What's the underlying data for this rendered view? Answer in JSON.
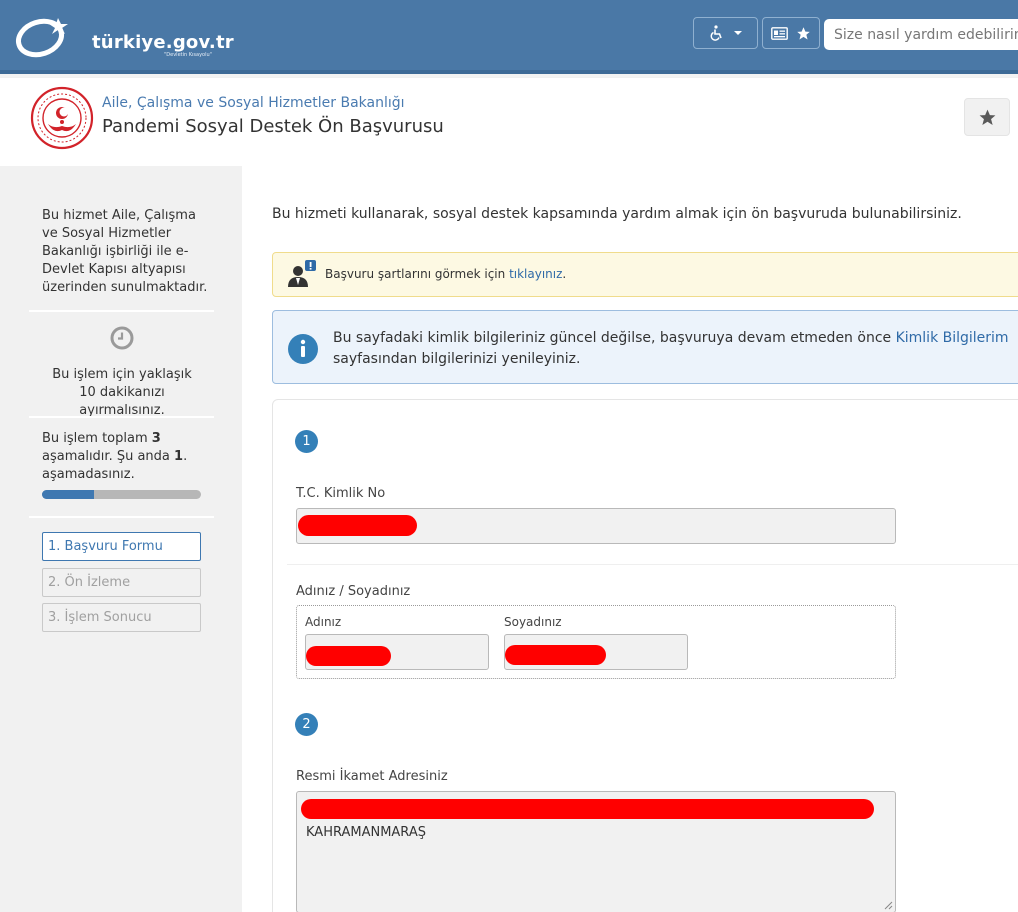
{
  "brand": {
    "name": "türkiye.gov.tr",
    "tagline": "\"Devletin Kısayolu\""
  },
  "topbar": {
    "accessibility_icon": "wheelchair-icon",
    "chevron_icon": "chevron-down-icon",
    "id_card_icon": "id-card-icon",
    "star_icon": "star-icon",
    "search_placeholder": "Size nasıl yardım edebilirim?"
  },
  "agency": {
    "ministry": "Aile, Çalışma ve Sosyal Hizmetler Bakanlığı",
    "service": "Pandemi Sosyal Destek Ön Başvurusu",
    "favorite_icon": "star-icon"
  },
  "sidebar": {
    "about": "Bu hizmet Aile, Çalışma ve Sosyal Hizmetler Bakanlığı işbirliği ile e-Devlet Kapısı altyapısı üzerinden sunulmaktadır.",
    "time_note": "Bu işlem için yaklaşık 10 dakikanızı ayırmalısınız.",
    "stage_text_a": "Bu işlem toplam ",
    "stage_total": "3",
    "stage_text_b": " aşamalıdır. Şu anda ",
    "stage_current": "1",
    "stage_text_c": ". aşamadasınız.",
    "progress_fraction": 0.33,
    "steps": [
      {
        "label": "1. Başvuru Formu",
        "active": true
      },
      {
        "label": "2. Ön İzleme",
        "active": false
      },
      {
        "label": "3. İşlem Sonucu",
        "active": false
      }
    ]
  },
  "main": {
    "intro": "Bu hizmeti kullanarak, sosyal destek kapsamında yardım almak için ön başvuruda bulunabilirsiniz.",
    "warn_text": "Başvuru şartlarını görmek için ",
    "warn_link": "tıklayınız",
    "warn_end": ".",
    "info_text_a": "Bu sayfadaki kimlik bilgileriniz güncel değilse, başvuruya devam etmeden önce ",
    "info_link": "Kimlik Bilgilerim",
    "info_text_b": " sayfasından bilgilerinizi yenileyiniz."
  },
  "form": {
    "section1_num": "1",
    "tc_label": "T.C. Kimlik No",
    "name_group_label": "Adınız / Soyadınız",
    "first_name_label": "Adınız",
    "last_name_label": "Soyadınız",
    "section2_num": "2",
    "address_label": "Resmi İkamet Adresiniz",
    "address_city": "KAHRAMANMARAŞ"
  }
}
